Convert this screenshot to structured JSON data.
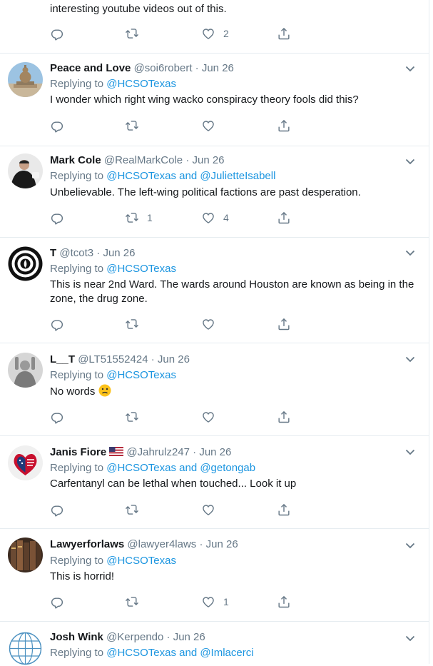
{
  "top_tweet": {
    "text_tail": "interesting youtube videos out of this.",
    "likes": "2"
  },
  "replying_prefix": "Replying to ",
  "tweets": [
    {
      "name": "Peace and Love",
      "handle": "@soi6robert",
      "date": "Jun 26",
      "replying_to": "@HCSOTexas",
      "text": "I wonder which right wing wacko conspiracy theory fools did this?",
      "retweets": "",
      "likes": ""
    },
    {
      "name": "Mark Cole",
      "handle": "@RealMarkCole",
      "date": "Jun 26",
      "replying_to": "@HCSOTexas and @JulietteIsabell",
      "text": "Unbelievable. The left-wing political factions are past desperation.",
      "retweets": "1",
      "likes": "4"
    },
    {
      "name": "T",
      "handle": "@tcot3",
      "date": "Jun 26",
      "replying_to": "@HCSOTexas",
      "text": "This is near 2nd Ward. The wards around Houston are known as being in the zone, the drug zone.",
      "retweets": "",
      "likes": ""
    },
    {
      "name": "L__T",
      "handle": "@LT51552424",
      "date": "Jun 26",
      "replying_to": "@HCSOTexas",
      "text": "No words",
      "retweets": "",
      "likes": ""
    },
    {
      "name": "Janis Fiore",
      "handle": "@Jahrulz247",
      "date": "Jun 26",
      "replying_to": "@HCSOTexas and @getongab",
      "text": "Carfentanyl can be lethal when touched... Look it up",
      "retweets": "",
      "likes": ""
    },
    {
      "name": "Lawyerforlaws",
      "handle": "@lawyer4laws",
      "date": "Jun 26",
      "replying_to": "@HCSOTexas",
      "text": "This is horrid!",
      "retweets": "",
      "likes": "1"
    },
    {
      "name": "Josh Wink",
      "handle": "@Kerpendo",
      "date": "Jun 26",
      "replying_to": "@HCSOTexas and @Imlacerci",
      "text": "",
      "retweets": "",
      "likes": ""
    }
  ],
  "icons": {
    "reply": "reply-icon",
    "retweet": "retweet-icon",
    "like": "heart-icon",
    "share": "share-icon",
    "more": "chevron-down-icon"
  },
  "colors": {
    "link": "#1b95e0",
    "muted": "#657786",
    "divider": "#e6ecf0"
  }
}
